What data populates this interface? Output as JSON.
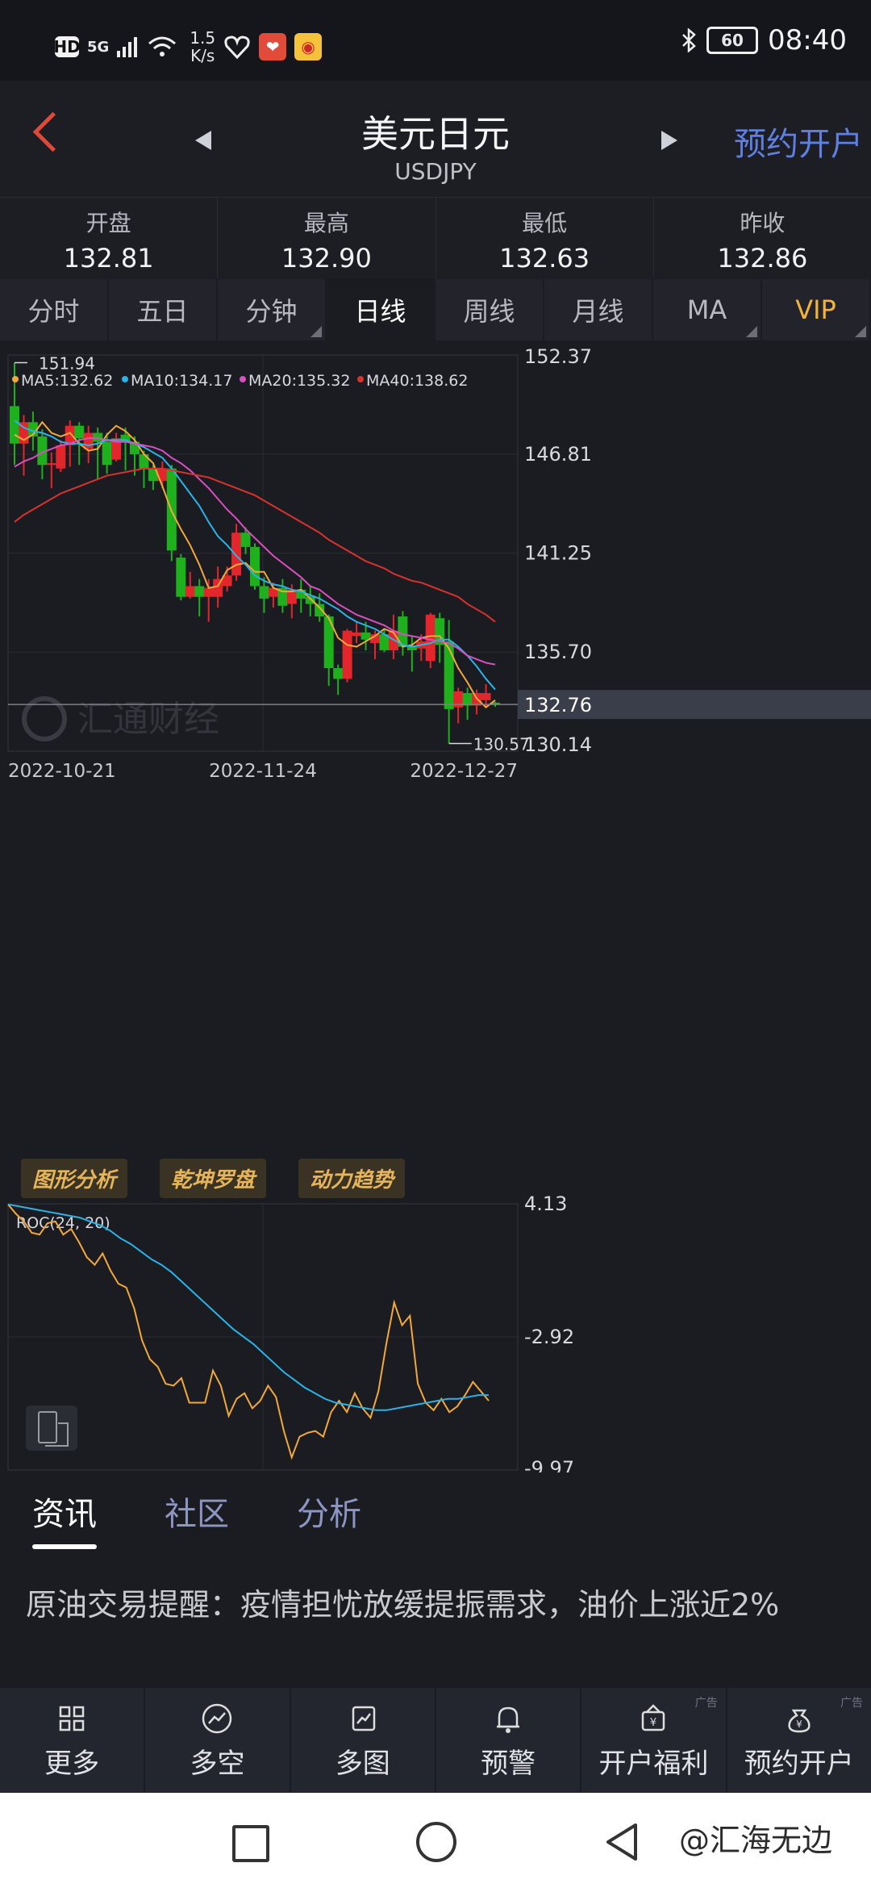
{
  "status_bar": {
    "hd": "HD",
    "signal": "5G",
    "net_speed_top": "1.5",
    "net_speed_bottom": "K/s",
    "battery": "60",
    "time": "08:40"
  },
  "header": {
    "title": "美元日元",
    "subtitle": "USDJPY",
    "open_account": "预约开户"
  },
  "quote": [
    {
      "label": "开盘",
      "value": "132.81"
    },
    {
      "label": "最高",
      "value": "132.90"
    },
    {
      "label": "最低",
      "value": "132.63"
    },
    {
      "label": "昨收",
      "value": "132.86"
    }
  ],
  "period_tabs": [
    "分时",
    "五日",
    "分钟",
    "日线",
    "周线",
    "月线",
    "MA",
    "VIP"
  ],
  "active_tab": "日线",
  "tools": [
    "图形分析",
    "乾坤罗盘",
    "动力趋势"
  ],
  "news_tabs": [
    "资讯",
    "社区",
    "分析"
  ],
  "news_headline": "原油交易提醒：疫情担忧放缓提振需求，油价上涨近2%",
  "bottom_nav": [
    "更多",
    "多空",
    "多图",
    "预警",
    "开户福利",
    "预约开户"
  ],
  "ad_tag": "广告",
  "footer_watermark": "@汇海无边",
  "colors": {
    "up": "#e3262b",
    "down": "#1fb01d",
    "ma5": "#f2a93b",
    "ma10": "#2ab3e8",
    "ma20": "#d94fbf",
    "ma40": "#d9322e",
    "accent": "#5f7fe2",
    "vip": "#f2b33d"
  },
  "chart_data": [
    {
      "type": "candlestick",
      "title": "",
      "legend": [
        {
          "name": "MA5",
          "value": "132.62"
        },
        {
          "name": "MA10",
          "value": "134.17"
        },
        {
          "name": "MA20",
          "value": "135.32"
        },
        {
          "name": "MA40",
          "value": "138.62"
        }
      ],
      "y_ticks": [
        "152.37",
        "146.81",
        "141.25",
        "135.70",
        "130.14"
      ],
      "ylim": [
        130.14,
        152.37
      ],
      "x_ticks": [
        "2022-10-21",
        "2022-11-24",
        "2022-12-27"
      ],
      "max_label": "151.94",
      "min_label": "130.57",
      "current_price": "132.76",
      "watermark": "汇通财经",
      "candles": [
        [
          149.5,
          147.4,
          151.94,
          146.2
        ],
        [
          147.4,
          148.6,
          149.0,
          145.6
        ],
        [
          148.6,
          147.8,
          149.2,
          147.0
        ],
        [
          147.8,
          146.2,
          148.2,
          145.4
        ],
        [
          146.2,
          146.3,
          146.9,
          144.9
        ],
        [
          146.0,
          147.3,
          147.6,
          145.8
        ],
        [
          147.3,
          148.4,
          148.7,
          146.1
        ],
        [
          148.4,
          147.7,
          148.6,
          146.2
        ],
        [
          147.1,
          148.0,
          148.4,
          146.3
        ],
        [
          148.0,
          147.5,
          148.3,
          145.4
        ],
        [
          147.5,
          146.2,
          148.0,
          145.7
        ],
        [
          146.5,
          147.7,
          148.0,
          146.4
        ],
        [
          147.9,
          147.5,
          148.3,
          145.9
        ],
        [
          147.5,
          146.8,
          147.8,
          145.6
        ],
        [
          146.8,
          146.0,
          147.0,
          144.9
        ],
        [
          146.0,
          145.3,
          146.2,
          144.8
        ],
        [
          145.3,
          146.0,
          146.4,
          144.9
        ],
        [
          146.0,
          141.4,
          146.2,
          140.8
        ],
        [
          141.0,
          138.8,
          141.2,
          138.6
        ],
        [
          138.8,
          139.4,
          140.2,
          138.7
        ],
        [
          139.4,
          138.8,
          139.8,
          137.7
        ],
        [
          138.8,
          139.3,
          139.8,
          137.4
        ],
        [
          138.8,
          139.8,
          140.5,
          138.2
        ],
        [
          139.4,
          140.0,
          140.5,
          139.1
        ],
        [
          140.0,
          142.4,
          142.9,
          139.7
        ],
        [
          142.4,
          141.6,
          142.7,
          141.2
        ],
        [
          141.6,
          139.4,
          141.8,
          139.2
        ],
        [
          139.4,
          138.7,
          139.9,
          137.9
        ],
        [
          138.8,
          139.3,
          139.6,
          138.2
        ],
        [
          139.3,
          138.3,
          139.8,
          137.9
        ],
        [
          138.4,
          139.2,
          139.5,
          137.6
        ],
        [
          139.2,
          138.7,
          139.8,
          137.9
        ],
        [
          138.8,
          138.4,
          139.4,
          137.7
        ],
        [
          138.4,
          137.7,
          139.0,
          137.4
        ],
        [
          137.7,
          134.8,
          137.8,
          133.8
        ],
        [
          134.8,
          134.2,
          135.0,
          133.3
        ],
        [
          134.2,
          136.9,
          137.0,
          134.0
        ],
        [
          136.6,
          136.8,
          137.4,
          136.2
        ],
        [
          136.8,
          136.4,
          137.4,
          135.8
        ],
        [
          136.2,
          136.7,
          136.9,
          135.3
        ],
        [
          136.7,
          135.8,
          137.0,
          135.7
        ],
        [
          135.8,
          136.9,
          137.8,
          135.3
        ],
        [
          137.7,
          136.0,
          138.0,
          135.5
        ],
        [
          136.0,
          135.8,
          136.6,
          134.6
        ],
        [
          135.9,
          136.3,
          136.7,
          135.2
        ],
        [
          135.2,
          137.8,
          137.9,
          134.8
        ],
        [
          137.6,
          136.1,
          137.9,
          135.1
        ],
        [
          136.3,
          132.5,
          137.5,
          130.57
        ],
        [
          132.6,
          133.5,
          133.7,
          131.7
        ],
        [
          133.4,
          132.7,
          133.7,
          131.9
        ],
        [
          132.7,
          133.4,
          133.6,
          132.2
        ],
        [
          133.0,
          133.4,
          133.9,
          132.6
        ],
        [
          132.86,
          132.76,
          132.9,
          132.63
        ]
      ],
      "series": [
        {
          "name": "MA5",
          "values": [
            147.9,
            147.6,
            147.9,
            148.6,
            148.0,
            147.8,
            148.0,
            147.4,
            147.0,
            147.1,
            147.9,
            148.4,
            148.1,
            147.6,
            146.8,
            146.3,
            145.0,
            143.6,
            142.6,
            141.7,
            140.6,
            139.3,
            139.4,
            140.3,
            140.6,
            140.7,
            140.2,
            140.2,
            139.3,
            139.1,
            139.1,
            139.2,
            138.7,
            138.2,
            137.6,
            136.5,
            136.1,
            136.0,
            136.3,
            136.6,
            137.0,
            136.8,
            136.0,
            136.1,
            136.5,
            136.6,
            136.6,
            135.9,
            134.8,
            134.0,
            133.1,
            132.6,
            133.0
          ]
        },
        {
          "name": "MA10",
          "values": [
            148.7,
            148.3,
            148.1,
            148.0,
            147.8,
            147.5,
            147.4,
            147.4,
            147.3,
            147.4,
            147.6,
            147.6,
            147.6,
            147.4,
            147.2,
            146.9,
            146.6,
            146.0,
            145.3,
            144.6,
            143.9,
            143.0,
            142.2,
            141.7,
            141.1,
            140.6,
            140.0,
            139.7,
            139.5,
            139.4,
            139.2,
            139.1,
            138.9,
            138.7,
            138.4,
            138.1,
            137.7,
            137.4,
            137.2,
            137.0,
            136.7,
            136.4,
            136.1,
            136.0,
            136.1,
            136.2,
            136.4,
            136.4,
            136.0,
            135.5,
            134.9,
            134.2,
            133.6
          ]
        },
        {
          "name": "MA20",
          "values": [
            146.1,
            146.4,
            146.6,
            146.9,
            147.1,
            147.3,
            147.4,
            147.6,
            147.7,
            147.7,
            147.6,
            147.5,
            147.5,
            147.4,
            147.3,
            147.2,
            147.0,
            146.6,
            146.3,
            145.9,
            145.4,
            144.9,
            144.3,
            143.7,
            143.2,
            142.6,
            142.1,
            141.6,
            141.1,
            140.7,
            140.3,
            139.9,
            139.4,
            139.2,
            138.8,
            138.4,
            138.1,
            137.8,
            137.6,
            137.4,
            137.2,
            136.9,
            136.7,
            136.6,
            136.5,
            136.4,
            136.3,
            136.2,
            135.9,
            135.5,
            135.3,
            135.1,
            135.0
          ]
        },
        {
          "name": "MA40",
          "values": [
            143.0,
            143.4,
            143.7,
            144.0,
            144.3,
            144.6,
            144.8,
            145.0,
            145.2,
            145.4,
            145.6,
            145.7,
            145.8,
            145.9,
            146.0,
            146.0,
            146.0,
            145.9,
            145.8,
            145.7,
            145.6,
            145.5,
            145.3,
            145.1,
            144.9,
            144.7,
            144.5,
            144.2,
            143.9,
            143.6,
            143.3,
            143.0,
            142.7,
            142.4,
            142.0,
            141.7,
            141.4,
            141.1,
            140.8,
            140.6,
            140.4,
            140.1,
            139.9,
            139.7,
            139.6,
            139.4,
            139.2,
            139.0,
            138.8,
            138.4,
            138.1,
            137.8,
            137.4
          ]
        }
      ]
    },
    {
      "type": "line",
      "title": "",
      "label": "ROC(24, 20)",
      "y_ticks": [
        "4.13",
        "-2.92",
        "-9.97"
      ],
      "ylim": [
        -9.97,
        4.13
      ],
      "series": [
        {
          "name": "ROC",
          "values": [
            4.1,
            3.6,
            3.2,
            2.6,
            2.5,
            3.1,
            3.2,
            2.5,
            2.8,
            2.1,
            1.3,
            0.9,
            1.5,
            0.6,
            -0.1,
            -0.3,
            -1.4,
            -3.1,
            -4.1,
            -4.5,
            -5.4,
            -5.5,
            -5.1,
            -6.4,
            -6.4,
            -6.4,
            -4.7,
            -5.5,
            -7.1,
            -6.2,
            -5.9,
            -6.7,
            -6.3,
            -5.5,
            -6.1,
            -7.9,
            -9.3,
            -8.2,
            -8.0,
            -7.9,
            -8.2,
            -6.9,
            -6.3,
            -6.9,
            -5.9,
            -6.7,
            -7.2,
            -5.8,
            -3.3,
            -1.1,
            -2.3,
            -1.8,
            -5.4,
            -6.4,
            -6.8,
            -6.2,
            -6.9,
            -6.6,
            -6.0,
            -5.3,
            -5.8,
            -6.3
          ]
        },
        {
          "name": "ROC-MA",
          "values": [
            4.1,
            4.0,
            3.9,
            3.8,
            3.7,
            3.6,
            3.5,
            3.4,
            3.2,
            3.0,
            2.7,
            2.3,
            2.0,
            1.6,
            1.2,
            0.9,
            0.5,
            0.0,
            -0.5,
            -1.0,
            -1.5,
            -2.0,
            -2.5,
            -2.9,
            -3.3,
            -3.8,
            -4.3,
            -4.8,
            -5.2,
            -5.6,
            -5.9,
            -6.2,
            -6.4,
            -6.5,
            -6.6,
            -6.7,
            -6.8,
            -6.8,
            -6.7,
            -6.6,
            -6.5,
            -6.4,
            -6.3,
            -6.2,
            -6.2,
            -6.1,
            -6.0,
            -6.0
          ]
        }
      ]
    }
  ]
}
